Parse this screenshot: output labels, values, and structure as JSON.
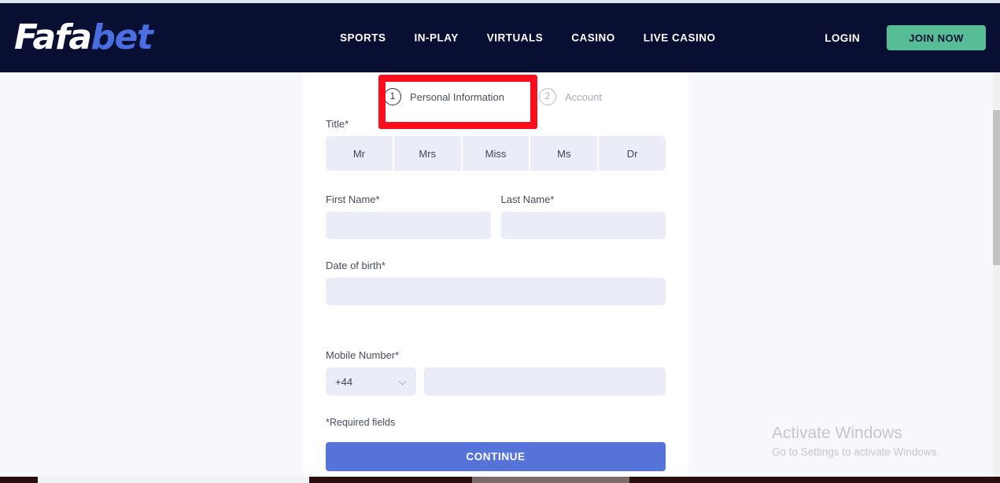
{
  "header": {
    "logo": {
      "part1": "Fafa",
      "part2": "bet"
    },
    "nav": [
      {
        "label": "SPORTS"
      },
      {
        "label": "IN-PLAY"
      },
      {
        "label": "VIRTUALS"
      },
      {
        "label": "CASINO"
      },
      {
        "label": "LIVE CASINO"
      }
    ],
    "login_label": "LOGIN",
    "join_label": "JOIN NOW",
    "bg_color": "#090f33",
    "join_color": "#56bd96"
  },
  "steps": [
    {
      "number": "1",
      "label": "Personal Information",
      "active": true
    },
    {
      "number": "2",
      "label": "Account",
      "active": false
    }
  ],
  "annotation": {
    "color": "#fc0d1b"
  },
  "form": {
    "title_label": "Title*",
    "title_options": [
      {
        "label": "Mr"
      },
      {
        "label": "Mrs"
      },
      {
        "label": "Miss"
      },
      {
        "label": "Ms"
      },
      {
        "label": "Dr"
      }
    ],
    "first_name_label": "First Name*",
    "first_name_value": "",
    "first_name_placeholder": "",
    "last_name_label": "Last Name*",
    "last_name_value": "",
    "last_name_placeholder": "",
    "dob_label": "Date of birth*",
    "dob_value": "",
    "dob_placeholder": "",
    "mobile_label": "Mobile Number*",
    "country_code": "+44",
    "mobile_value": "",
    "mobile_placeholder": "",
    "required_note": "*Required fields",
    "continue_label": "CONTINUE",
    "continue_color": "#5573d8",
    "input_bg": "#eaecf8"
  },
  "watermark": {
    "title": "Activate Windows",
    "subtitle": "Go to Settings to activate Windows."
  }
}
